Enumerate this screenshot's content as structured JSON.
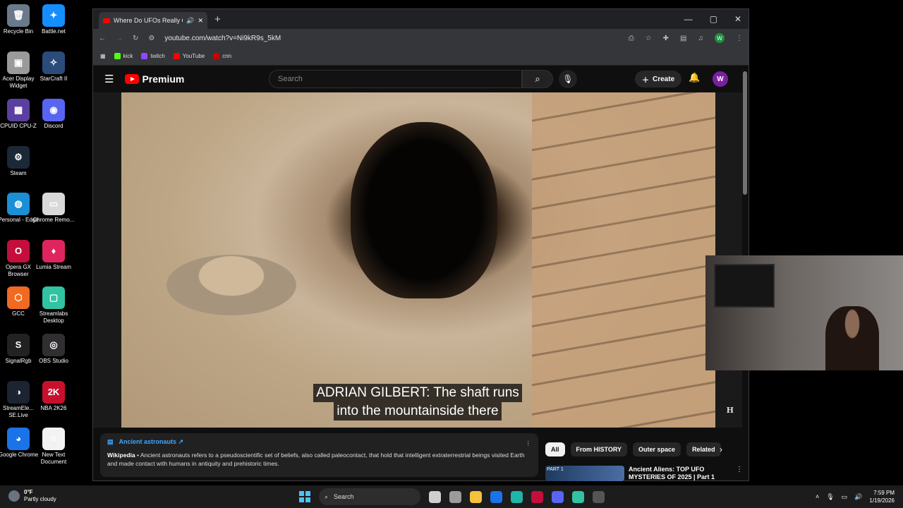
{
  "desktop": {
    "icons": [
      {
        "label": "Recycle Bin",
        "symbol": "🗑",
        "color": "#6b7a8a"
      },
      {
        "label": "Battle.net",
        "symbol": "✦",
        "color": "#148eff"
      },
      {
        "label": "Acer Display Widget",
        "symbol": "▣",
        "color": "#9a9a9a"
      },
      {
        "label": "StarCraft II",
        "symbol": "✧",
        "color": "#2b4c7a"
      },
      {
        "label": "CPUID CPU-Z",
        "symbol": "▦",
        "color": "#5b3fa0"
      },
      {
        "label": "Discord",
        "symbol": "◉",
        "color": "#5865f2"
      },
      {
        "label": "Steam",
        "symbol": "⚙",
        "color": "#1b2838"
      },
      {
        "label": "Personal - Edge",
        "symbol": "◍",
        "color": "#1a8fd6"
      },
      {
        "label": "Chrome Remo...",
        "symbol": "▭",
        "color": "#d9d9d9"
      },
      {
        "label": "Opera GX Browser",
        "symbol": "O",
        "color": "#c40e3c"
      },
      {
        "label": "Lumia Stream",
        "symbol": "♦",
        "color": "#e0245e"
      },
      {
        "label": "GCC",
        "symbol": "⬡",
        "color": "#f06a22"
      },
      {
        "label": "Streamlabs Desktop",
        "symbol": "▢",
        "color": "#31c3a2"
      },
      {
        "label": "SignalRgb",
        "symbol": "S",
        "color": "#222"
      },
      {
        "label": "OBS Studio",
        "symbol": "◎",
        "color": "#302e31"
      },
      {
        "label": "StreamEle... SE.Live",
        "symbol": "◑",
        "color": "#1c2432"
      },
      {
        "label": "NBA 2K26",
        "symbol": "2K",
        "color": "#c8102e"
      },
      {
        "label": "Google Chrome",
        "symbol": "◕",
        "color": "#1a73e8"
      },
      {
        "label": "New Text Document",
        "symbol": "≡",
        "color": "#f2f2f2"
      }
    ]
  },
  "browser": {
    "tab_title": "Where Do UFOs Really Com",
    "url": "youtube.com/watch?v=Ni9kR9s_5kM",
    "bookmarks": [
      {
        "label": "kick",
        "color": "#53fc18"
      },
      {
        "label": "twitch",
        "color": "#9146ff"
      },
      {
        "label": "YouTube",
        "color": "#ff0000"
      },
      {
        "label": "cnn",
        "color": "#cc0000"
      }
    ],
    "profile_initial": "W"
  },
  "youtube": {
    "logo_text": "Premium",
    "search_placeholder": "Search",
    "create_label": "Create",
    "avatar_initial": "W",
    "subtitle_line1": "ADRIAN GILBERT: The shaft runs",
    "subtitle_line2": "into the mountainside there",
    "channel_watermark": "H",
    "info_card": {
      "title": "Ancient astronauts ↗",
      "source": "Wikipedia",
      "text": " • Ancient astronauts refers to a pseudoscientific set of beliefs, also called paleocontact, that hold that intelligent extraterrestrial beings visited Earth and made contact with humans in antiquity and prehistoric times."
    },
    "chips": [
      "All",
      "From HISTORY",
      "Outer space",
      "Related"
    ],
    "rec_thumb_label": "PART 1",
    "rec_title": "Ancient Aliens: TOP UFO MYSTERIES OF 2025 | Part 1"
  },
  "taskbar": {
    "temperature": "0°F",
    "weather": "Partly cloudy",
    "search_label": "Search",
    "time": "7:59 PM",
    "date": "1/19/2026",
    "apps": [
      {
        "name": "task-view",
        "color": "#cfcfcf"
      },
      {
        "name": "widgets",
        "color": "#9b9b9b"
      },
      {
        "name": "file-explorer",
        "color": "#f3c13a"
      },
      {
        "name": "chrome",
        "color": "#1a73e8"
      },
      {
        "name": "edge",
        "color": "#1fb5a7"
      },
      {
        "name": "opera-gx",
        "color": "#c40e3c"
      },
      {
        "name": "discord",
        "color": "#5865f2"
      },
      {
        "name": "streamlabs",
        "color": "#31c3a2"
      },
      {
        "name": "obs",
        "color": "#555"
      }
    ]
  }
}
